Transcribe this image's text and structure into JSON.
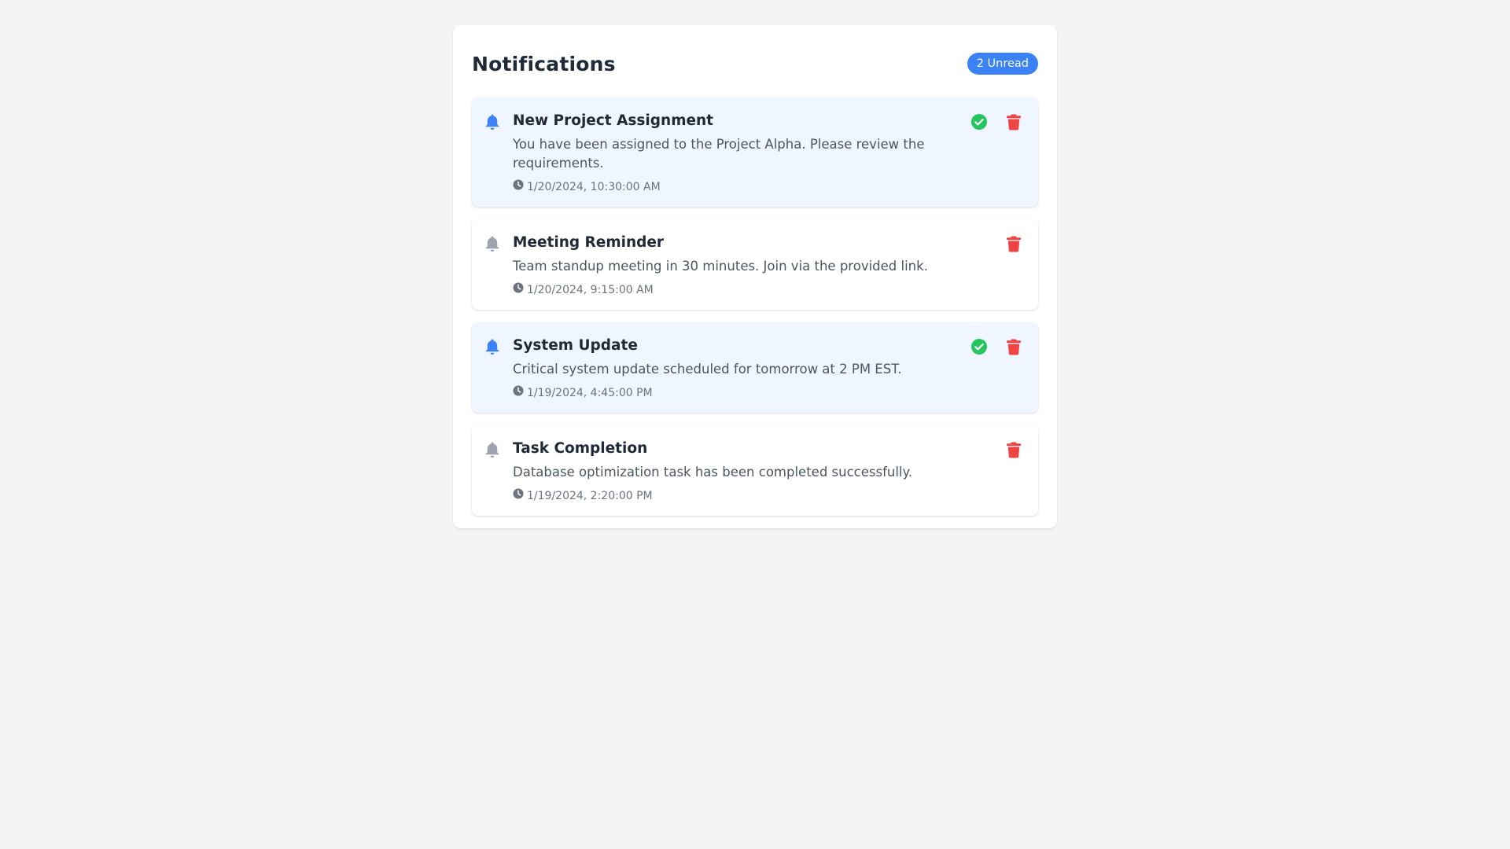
{
  "header": {
    "title": "Notifications",
    "unread_badge": "2 Unread"
  },
  "colors": {
    "accent": "#3b82f6",
    "unread_bg": "#eff6ff",
    "read_bg": "#ffffff",
    "check": "#22c55e",
    "delete": "#ef4444",
    "muted_icon": "#9ca3af"
  },
  "icons": {
    "bell": "bell-icon",
    "check": "check-circle-icon",
    "delete": "trash-icon",
    "time": "clock-icon"
  },
  "notifications": [
    {
      "title": "New Project Assignment",
      "message": "You have been assigned to the Project Alpha. Please review the requirements.",
      "timestamp": "1/20/2024, 10:30:00 AM",
      "unread": true
    },
    {
      "title": "Meeting Reminder",
      "message": "Team standup meeting in 30 minutes. Join via the provided link.",
      "timestamp": "1/20/2024, 9:15:00 AM",
      "unread": false
    },
    {
      "title": "System Update",
      "message": "Critical system update scheduled for tomorrow at 2 PM EST.",
      "timestamp": "1/19/2024, 4:45:00 PM",
      "unread": true
    },
    {
      "title": "Task Completion",
      "message": "Database optimization task has been completed successfully.",
      "timestamp": "1/19/2024, 2:20:00 PM",
      "unread": false
    }
  ]
}
